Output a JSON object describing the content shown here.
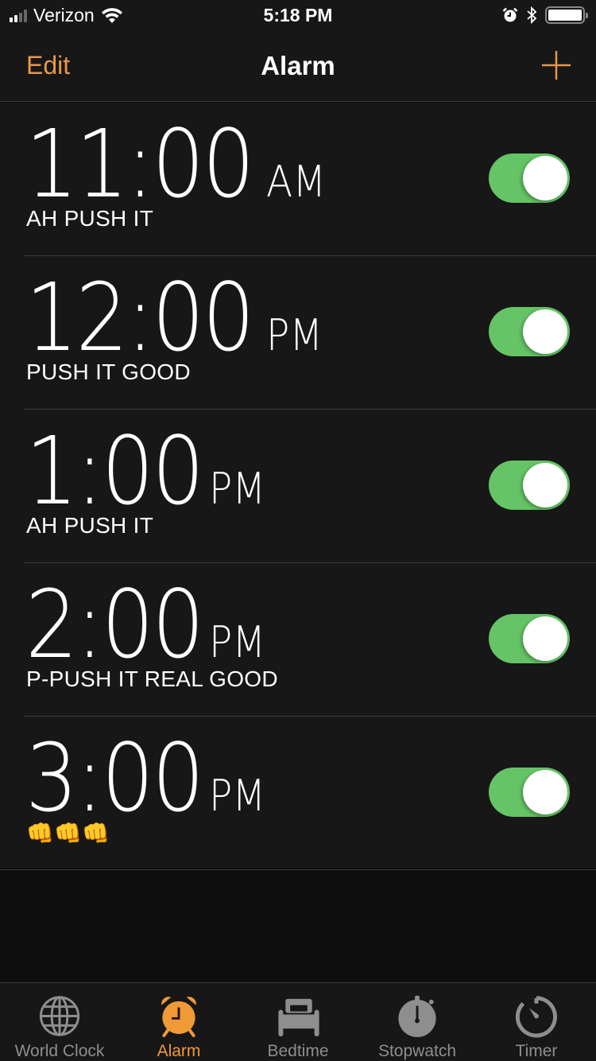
{
  "status_bar": {
    "carrier": "Verizon",
    "time": "5:18 PM",
    "signal_bars_filled": 2,
    "signal_bars_total": 4,
    "icons": [
      "signal-icon",
      "wifi-icon",
      "alarm-icon",
      "bluetooth-icon",
      "battery-icon"
    ],
    "battery_level": 1.0
  },
  "nav": {
    "edit_label": "Edit",
    "title": "Alarm",
    "add_icon": "plus-icon"
  },
  "colors": {
    "accent": "#f09a37",
    "toggle_on": "#65c466",
    "background": "#171717"
  },
  "alarms": [
    {
      "time": "11:00",
      "period": "AM",
      "label": "AH PUSH IT",
      "enabled": true
    },
    {
      "time": "12:00",
      "period": "PM",
      "label": "PUSH IT GOOD",
      "enabled": true
    },
    {
      "time": "1:00",
      "period": "PM",
      "label": "AH PUSH IT",
      "enabled": true
    },
    {
      "time": "2:00",
      "period": "PM",
      "label": "P-PUSH IT REAL GOOD",
      "enabled": true
    },
    {
      "time": "3:00",
      "period": "PM",
      "label": "👊👊👊",
      "enabled": true
    }
  ],
  "tabs": [
    {
      "label": "World Clock",
      "icon": "globe-icon",
      "active": false
    },
    {
      "label": "Alarm",
      "icon": "alarm-clock-icon",
      "active": true
    },
    {
      "label": "Bedtime",
      "icon": "bed-icon",
      "active": false
    },
    {
      "label": "Stopwatch",
      "icon": "stopwatch-icon",
      "active": false
    },
    {
      "label": "Timer",
      "icon": "timer-icon",
      "active": false
    }
  ]
}
